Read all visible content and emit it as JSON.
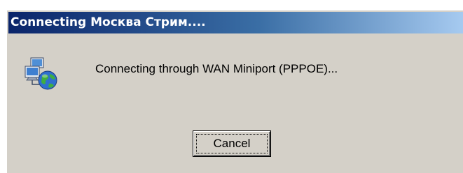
{
  "window": {
    "title": "Connecting Москва Стрим...."
  },
  "dialog": {
    "icon": "network-connection-globe-icon",
    "message": "Connecting through WAN Miniport (PPPOE)...",
    "cancel_label": "Cancel"
  },
  "colors": {
    "title_bar_start": "#0a246a",
    "title_bar_end": "#a6caf0",
    "dialog_background": "#d4d0c8",
    "title_text": "#ffffff"
  }
}
